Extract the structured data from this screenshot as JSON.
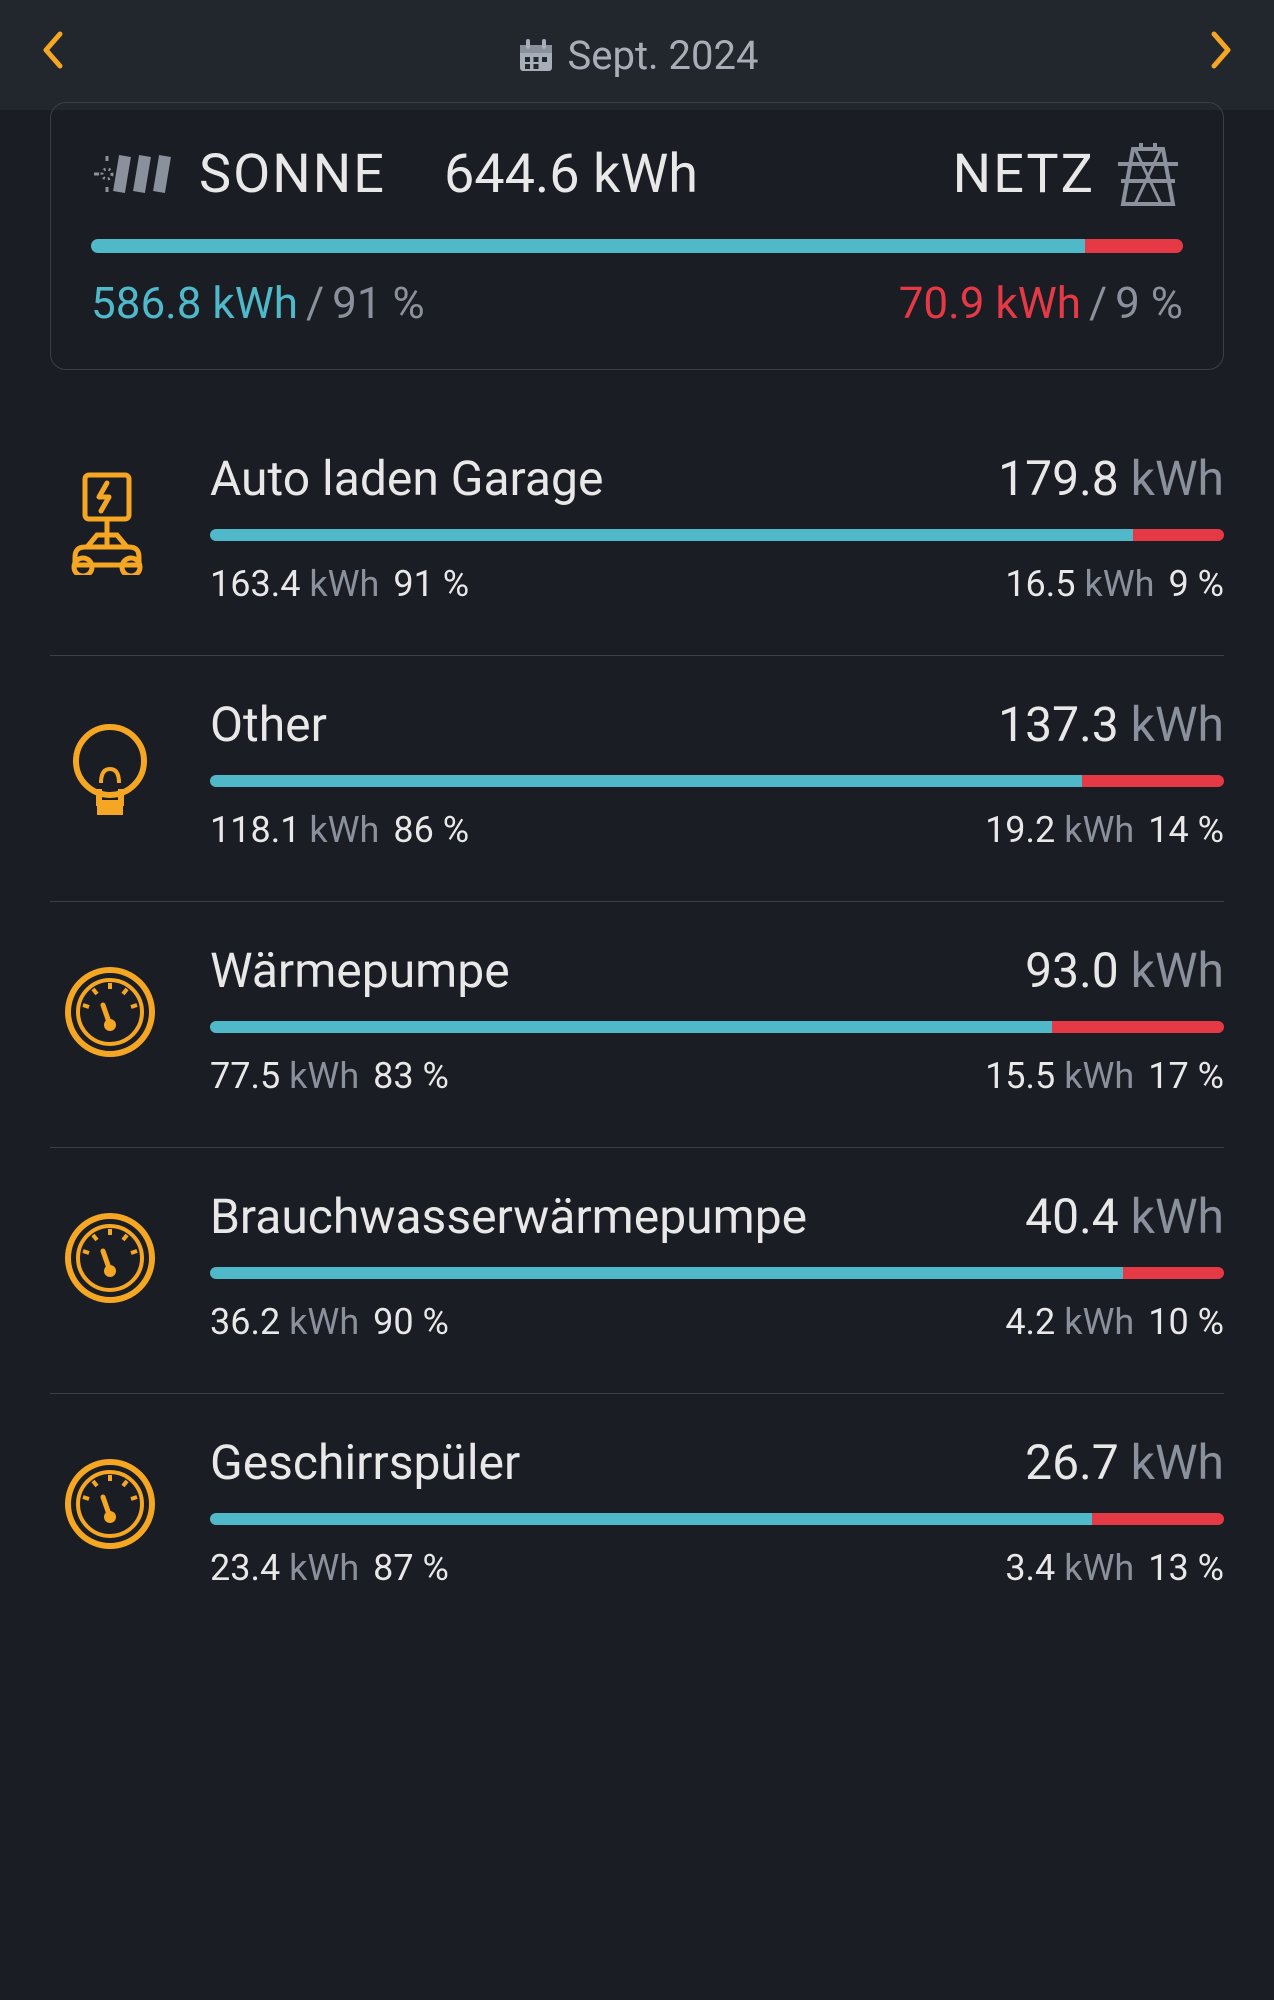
{
  "header": {
    "date_label": "Sept. 2024"
  },
  "summary": {
    "solar_label": "SONNE",
    "grid_label": "NETZ",
    "total": "644.6 kWh",
    "solar_value": "586.8 kWh",
    "solar_pct": "91 %",
    "grid_value": "70.9 kWh",
    "grid_pct": "9 %",
    "solar_bar_width": "91%",
    "grid_bar_width": "9%"
  },
  "items": [
    {
      "name": "Auto laden Garage",
      "icon": "ev-charger",
      "total_val": "179.8",
      "total_unit": "kWh",
      "solar_val": "163.4",
      "solar_unit": "kWh",
      "solar_pct": "91 %",
      "grid_val": "16.5",
      "grid_unit": "kWh",
      "grid_pct": "9 %",
      "solar_width": "91%",
      "grid_width": "9%"
    },
    {
      "name": "Other",
      "icon": "bulb",
      "total_val": "137.3",
      "total_unit": "kWh",
      "solar_val": "118.1",
      "solar_unit": "kWh",
      "solar_pct": "86 %",
      "grid_val": "19.2",
      "grid_unit": "kWh",
      "grid_pct": "14 %",
      "solar_width": "86%",
      "grid_width": "14%"
    },
    {
      "name": "Wärmepumpe",
      "icon": "meter",
      "total_val": "93.0",
      "total_unit": "kWh",
      "solar_val": "77.5",
      "solar_unit": "kWh",
      "solar_pct": "83 %",
      "grid_val": "15.5",
      "grid_unit": "kWh",
      "grid_pct": "17 %",
      "solar_width": "83%",
      "grid_width": "17%"
    },
    {
      "name": "Brauchwasserwärmepumpe",
      "icon": "meter",
      "total_val": "40.4",
      "total_unit": "kWh",
      "solar_val": "36.2",
      "solar_unit": "kWh",
      "solar_pct": "90 %",
      "grid_val": "4.2",
      "grid_unit": "kWh",
      "grid_pct": "10 %",
      "solar_width": "90%",
      "grid_width": "10%"
    },
    {
      "name": "Geschirrspüler",
      "icon": "meter",
      "total_val": "26.7",
      "total_unit": "kWh",
      "solar_val": "23.4",
      "solar_unit": "kWh",
      "solar_pct": "87 %",
      "grid_val": "3.4",
      "grid_unit": "kWh",
      "grid_pct": "13 %",
      "solar_width": "87%",
      "grid_width": "13%"
    }
  ],
  "colors": {
    "accent": "#f5a623",
    "solar": "#4fb8c9",
    "grid": "#e63946"
  }
}
